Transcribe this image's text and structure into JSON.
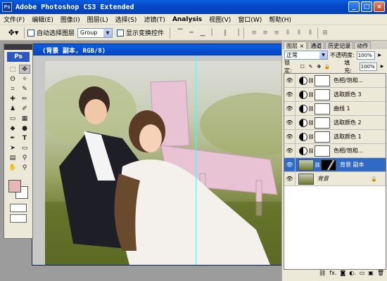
{
  "app": {
    "title": "Adobe Photoshop CS3 Extended",
    "logo_text": "Ps",
    "window_buttons": [
      "_",
      "□",
      "×"
    ]
  },
  "menu": [
    "文件(F)",
    "编辑(E)",
    "图像(I)",
    "图层(L)",
    "选择(S)",
    "滤镜(T)",
    "Analysis",
    "视图(V)",
    "窗口(W)",
    "帮助(H)"
  ],
  "options": {
    "auto_select_label": "自动选择图层",
    "auto_select_value": "Group",
    "show_transform_label": "显示变换控件"
  },
  "document": {
    "title": "(背景 副本, RGB/8)"
  },
  "tools": {
    "logo": "Ps",
    "fg_color": "#e7b6b7",
    "bg_color": "#ffffff"
  },
  "layers_panel": {
    "tabs": [
      "图层 ×",
      "通道",
      "历史记录",
      "动作"
    ],
    "blend_mode": "正常",
    "opacity_label": "不透明度:",
    "opacity_value": "100%",
    "lock_label": "锁定:",
    "fill_label": "填充:",
    "fill_value": "100%",
    "layers": [
      {
        "name": "色相/饱和...",
        "type": "adjustment"
      },
      {
        "name": "选取颜色 3",
        "type": "adjustment"
      },
      {
        "name": "曲线 1",
        "type": "adjustment"
      },
      {
        "name": "选取颜色 2",
        "type": "adjustment"
      },
      {
        "name": "选取颜色 1",
        "type": "adjustment"
      },
      {
        "name": "色相/饱和...",
        "type": "adjustment"
      },
      {
        "name": "背景 副本",
        "type": "image",
        "selected": true
      },
      {
        "name": "背景",
        "type": "background"
      }
    ]
  }
}
